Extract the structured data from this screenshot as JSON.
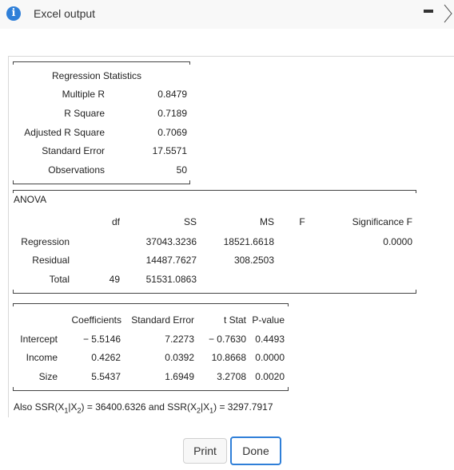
{
  "window": {
    "title": "Excel output",
    "info_icon": "i"
  },
  "regression_statistics": {
    "heading": "Regression  Statistics",
    "rows": [
      {
        "label": "Multiple R",
        "value": "0.8479"
      },
      {
        "label": "R Square",
        "value": "0.7189"
      },
      {
        "label": "Adjusted R Square",
        "value": "0.7069"
      },
      {
        "label": "Standard Error",
        "value": "17.5571"
      },
      {
        "label": "Observations",
        "value": "50"
      }
    ]
  },
  "anova": {
    "heading": "ANOVA",
    "columns": [
      "df",
      "SS",
      "MS",
      "F",
      "Significance F"
    ],
    "rows": [
      {
        "label": "Regression",
        "df": "",
        "ss": "37043.3236",
        "ms": "18521.6618",
        "f": "",
        "sig": "0.0000"
      },
      {
        "label": "Residual",
        "df": "",
        "ss": "14487.7627",
        "ms": "308.2503",
        "f": "",
        "sig": ""
      },
      {
        "label": "Total",
        "df": "49",
        "ss": "51531.0863",
        "ms": "",
        "f": "",
        "sig": ""
      }
    ]
  },
  "coefficients": {
    "columns": [
      "Coefficients",
      "Standard Error",
      "t Stat",
      "P-value"
    ],
    "rows": [
      {
        "label": "Intercept",
        "coef": "− 5.5146",
        "se": "7.2273",
        "t": "− 0.7630",
        "p": "0.4493"
      },
      {
        "label": "Income",
        "coef": "0.4262",
        "se": "0.0392",
        "t": "10.8668",
        "p": "0.0000"
      },
      {
        "label": "Size",
        "coef": "5.5437",
        "se": "1.6949",
        "t": "3.2708",
        "p": "0.0020"
      }
    ]
  },
  "note": {
    "prefix": "Also SSR(X",
    "s1": "1",
    "mid1": "|X",
    "s2": "2",
    "mid2": ") = 36400.6326 and SSR(X",
    "s3": "2",
    "mid3": "|X",
    "s4": "1",
    "suffix": ") = 3297.7917"
  },
  "buttons": {
    "print": "Print",
    "done": "Done"
  },
  "colors": {
    "accent": "#2f7fd8"
  }
}
